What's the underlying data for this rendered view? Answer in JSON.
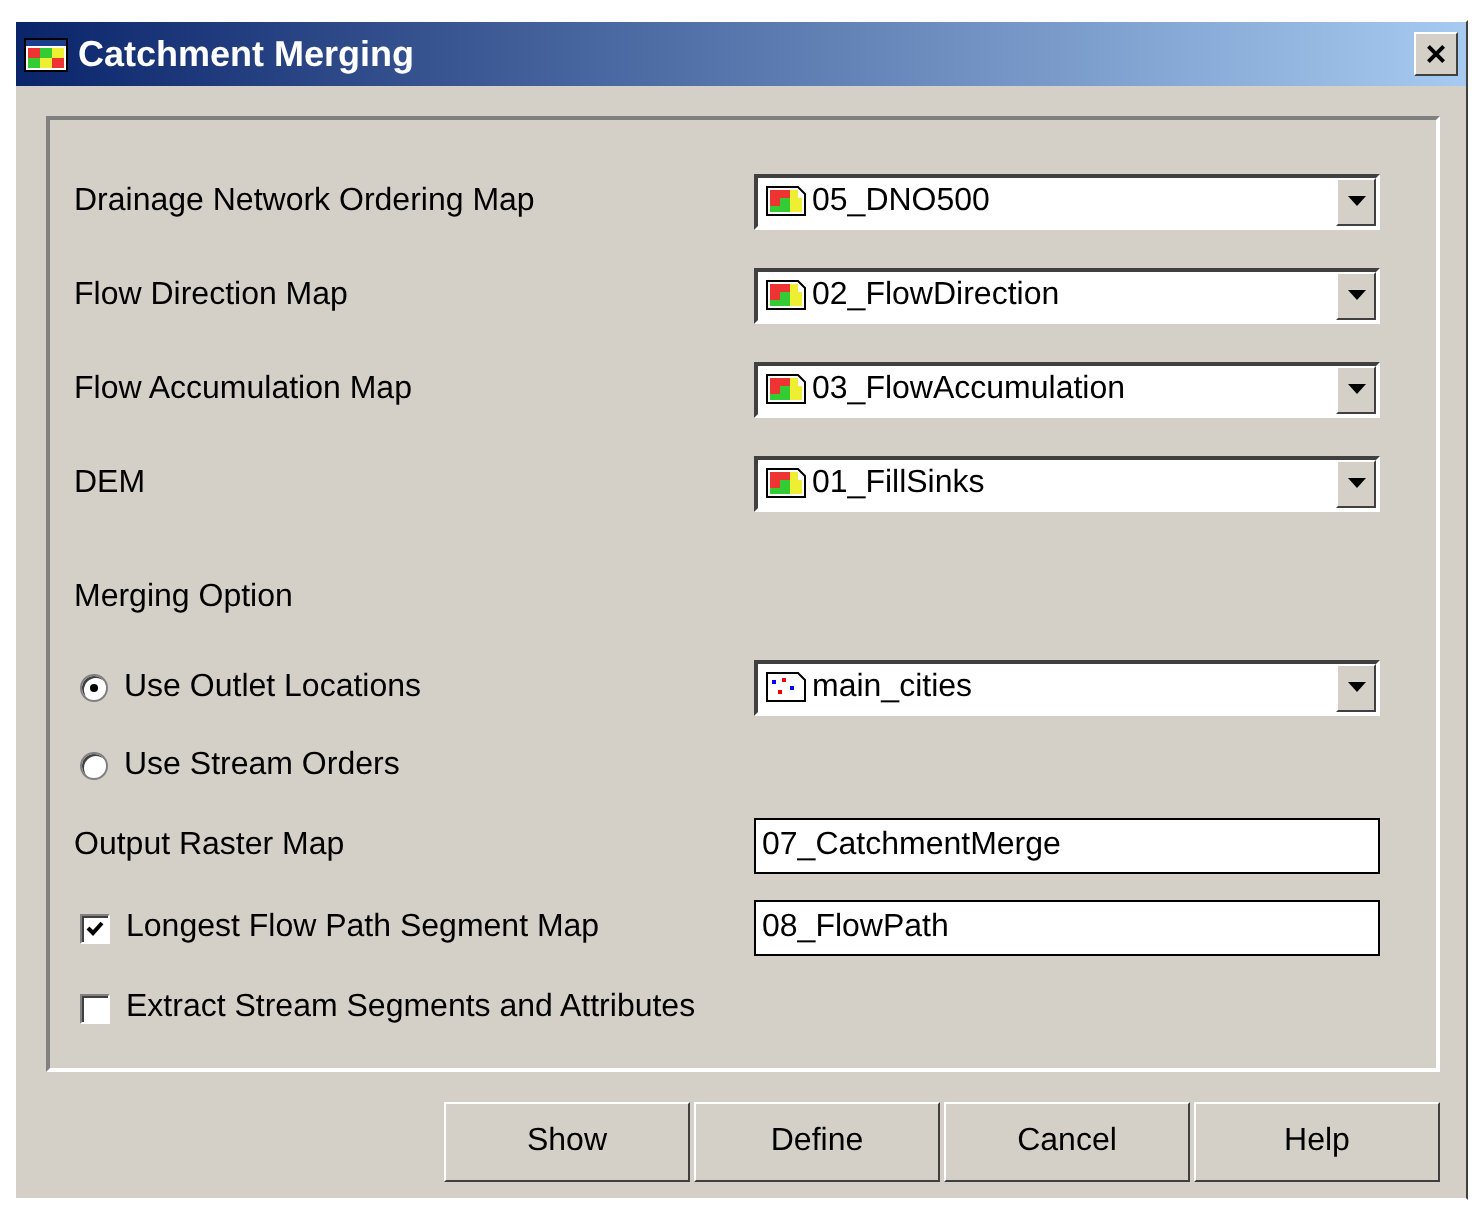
{
  "window": {
    "title": "Catchment Merging",
    "close": "×"
  },
  "rows": [
    {
      "kind": "select",
      "label": "Drainage Network Ordering Map",
      "value": "05_DNO500"
    },
    {
      "kind": "select",
      "label": "Flow Direction Map",
      "value": "02_FlowDirection"
    },
    {
      "kind": "select",
      "label": "Flow Accumulation Map",
      "value": "03_FlowAccumulation"
    },
    {
      "kind": "select",
      "label": "DEM",
      "value": "01_FillSinks"
    },
    {
      "kind": "heading",
      "label": "Merging Option"
    },
    {
      "kind": "radio",
      "label": "Use Outlet Locations",
      "selected": true,
      "value": "main_cities"
    },
    {
      "kind": "radio",
      "label": "Use Stream Orders",
      "selected": false
    },
    {
      "kind": "text",
      "label": "Output Raster Map",
      "value": "07_CatchmentMerge"
    },
    {
      "kind": "checkbox",
      "label": "Longest Flow Path Segment Map",
      "checked": true,
      "value": "08_FlowPath"
    },
    {
      "kind": "checkbox",
      "label": "Extract Stream Segments and Attributes",
      "checked": false
    }
  ],
  "buttons": [
    "Show",
    "Define",
    "Cancel",
    "Help"
  ]
}
